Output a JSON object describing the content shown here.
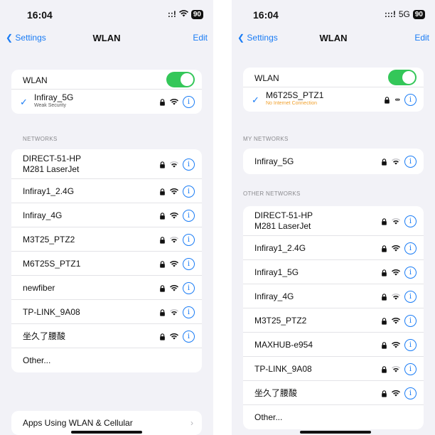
{
  "left": {
    "status": {
      "time": "16:04",
      "signal": "::!",
      "wifi": "ᯤ",
      "battery": "90"
    },
    "nav": {
      "back": "Settings",
      "title": "WLAN",
      "edit": "Edit"
    },
    "wlan_label": "WLAN",
    "connected": {
      "name": "Infiray_5G",
      "sub": "Weak Security"
    },
    "networks_header": "NETWORKS",
    "networks": [
      {
        "name": "DIRECT-51-HP\nM281 LaserJet"
      },
      {
        "name": "Infiray1_2.4G"
      },
      {
        "name": "Infiray_4G"
      },
      {
        "name": "M3T25_PTZ2"
      },
      {
        "name": "M6T25S_PTZ1"
      },
      {
        "name": "newfiber"
      },
      {
        "name": "TP-LINK_9A08"
      },
      {
        "name": "坐久了腰酸"
      }
    ],
    "other": "Other...",
    "apps_using": "Apps Using WLAN & Cellular"
  },
  "right": {
    "status": {
      "time": "16:04",
      "signal": ":::!",
      "net": "5G",
      "battery": "90"
    },
    "nav": {
      "back": "Settings",
      "title": "WLAN",
      "edit": "Edit"
    },
    "wlan_label": "WLAN",
    "connected": {
      "name": "M6T25S_PTZ1",
      "sub": "No Internet Connection"
    },
    "my_networks_header": "MY NETWORKS",
    "my_networks": [
      {
        "name": "Infiray_5G"
      }
    ],
    "other_header": "OTHER NETWORKS",
    "other_networks": [
      {
        "name": "DIRECT-51-HP\nM281 LaserJet"
      },
      {
        "name": "Infiray1_2.4G"
      },
      {
        "name": "Infiray1_5G"
      },
      {
        "name": "Infiray_4G"
      },
      {
        "name": "M3T25_PTZ2"
      },
      {
        "name": "MAXHUB-e954"
      },
      {
        "name": "TP-LINK_9A08"
      },
      {
        "name": "坐久了腰酸"
      }
    ],
    "other": "Other..."
  },
  "colors": {
    "accent": "#1a7cf5",
    "toggle_on": "#34c759",
    "warning": "#f0a02c"
  },
  "icons": {
    "lock": "lock-icon",
    "wifi": "wifi-icon",
    "info": "info-icon",
    "check": "checkmark-icon",
    "back": "chevron-left-icon"
  }
}
